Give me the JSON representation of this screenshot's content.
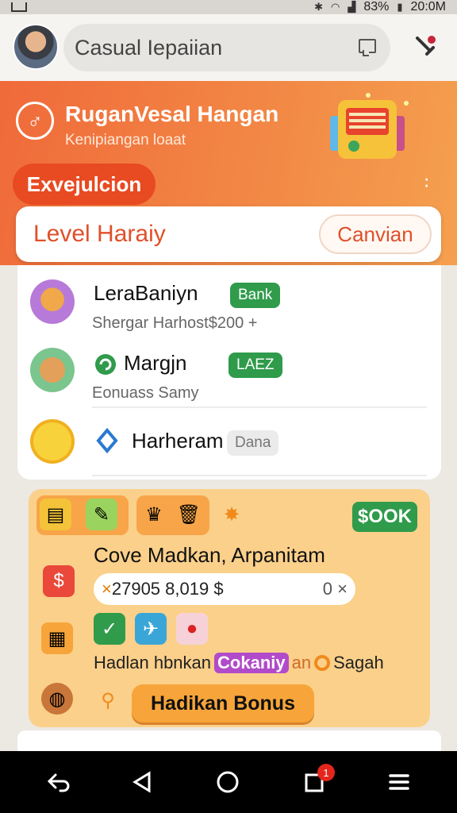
{
  "status_bar": {
    "battery": "83%",
    "time": "20:0M"
  },
  "app_bar": {
    "search_text": "Casual Iepaiian"
  },
  "banner": {
    "title": "RuganVesal Hangan",
    "subtitle": "Kenipiangan loaat",
    "exec_pill": "Exvejulcion",
    "level_text": "Level Haraiy",
    "level_button": "Canvian"
  },
  "list": {
    "items": [
      {
        "title": "LeraBaniyn",
        "tag": "Bank",
        "subtitle": "Shergar Harhost$200 +"
      },
      {
        "title": "Margjn",
        "tag": "LAEZ",
        "subtitle": "Eonuass Samy"
      },
      {
        "title": "Harheram",
        "tag": "Dana"
      }
    ]
  },
  "bonus": {
    "badge": "$OOK",
    "title": "Cove Madkan, Arpanitam",
    "value_left_mark": "×",
    "value_left": "27905 8,019 $",
    "value_right": "0 ×",
    "line_prefix": "Hadlan hbnkan",
    "line_highlight": "Cokaniy",
    "line_mid": "an",
    "line_suffix": "Sagah",
    "button": "Hadikan Bonus"
  },
  "nav": {
    "recents_badge": "1"
  },
  "colors": {
    "accent": "#f06a3a",
    "green": "#2f9b4b",
    "bonus_bg": "#fbd08a"
  }
}
